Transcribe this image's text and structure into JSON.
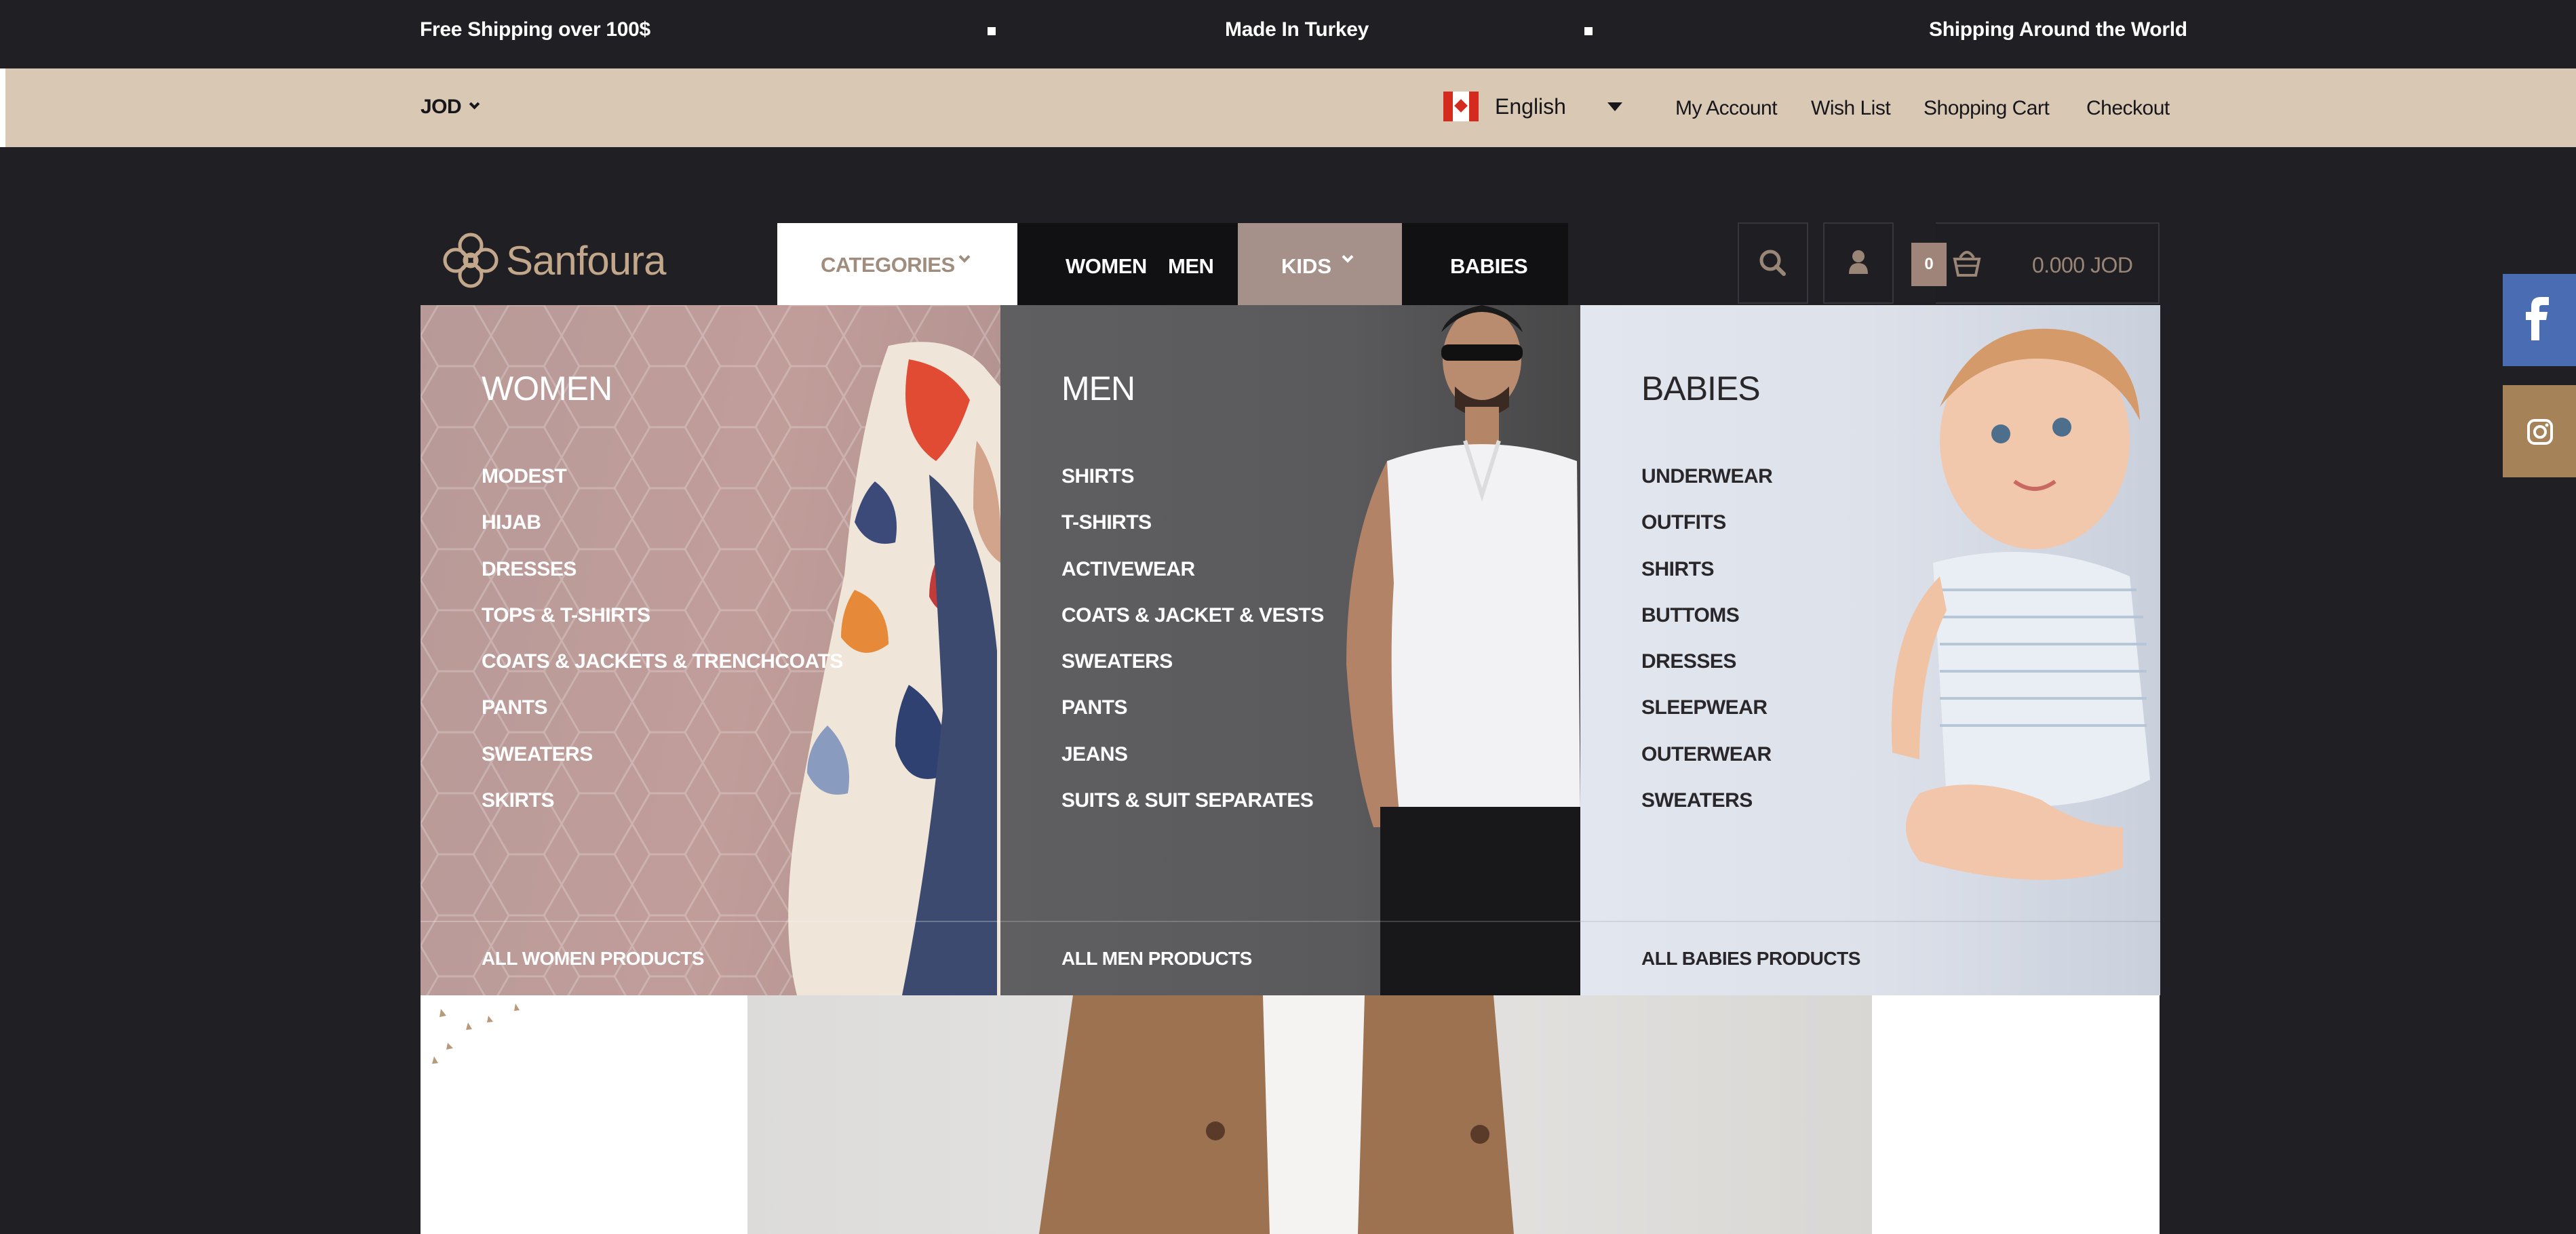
{
  "promo": {
    "left": "Free Shipping over 100$",
    "center": "Made In Turkey",
    "right": "Shipping Around the World"
  },
  "topbar": {
    "currency": "JOD",
    "language": "English",
    "links": [
      "My Account",
      "Wish List",
      "Shopping Cart",
      "Checkout"
    ]
  },
  "header": {
    "logo_text": "Sanfoura",
    "categories_label": "CATEGORIES",
    "nav": [
      "WOMEN",
      "MEN",
      "KIDS",
      "BABIES"
    ],
    "cart_count": "0",
    "cart_total": "0.000 JOD"
  },
  "mega_menu": {
    "women": {
      "title": "WOMEN",
      "items": [
        "MODEST",
        "HIJAB",
        "DRESSES",
        "TOPS & T-SHIRTS",
        "COATS & JACKETS & TRENCHCOATS",
        "PANTS",
        "SWEATERS",
        "SKIRTS"
      ],
      "all_link": "ALL WOMEN PRODUCTS"
    },
    "men": {
      "title": "MEN",
      "items": [
        "SHIRTS",
        "T-SHIRTS",
        "ACTIVEWEAR",
        "COATS & JACKET & VESTS",
        "SWEATERS",
        "PANTS",
        "JEANS",
        "SUITS & SUIT SEPARATES"
      ],
      "all_link": "ALL MEN PRODUCTS"
    },
    "babies": {
      "title": "BABIES",
      "items": [
        "UNDERWEAR",
        "OUTFITS",
        "SHIRTS",
        "BUTTOMS",
        "DRESSES",
        "SLEEPWEAR",
        "OUTERWEAR",
        "SWEATERS"
      ],
      "all_link": "ALL BABIES PRODUCTS"
    }
  },
  "social": {
    "facebook_icon": "facebook-icon",
    "instagram_icon": "instagram-icon"
  },
  "colors": {
    "background": "#201f24",
    "topbar": "#d8c8b4",
    "accent": "#c2a78a",
    "kids_active": "#a5908a",
    "facebook": "#4a6cb3",
    "instagram": "#a68259"
  }
}
